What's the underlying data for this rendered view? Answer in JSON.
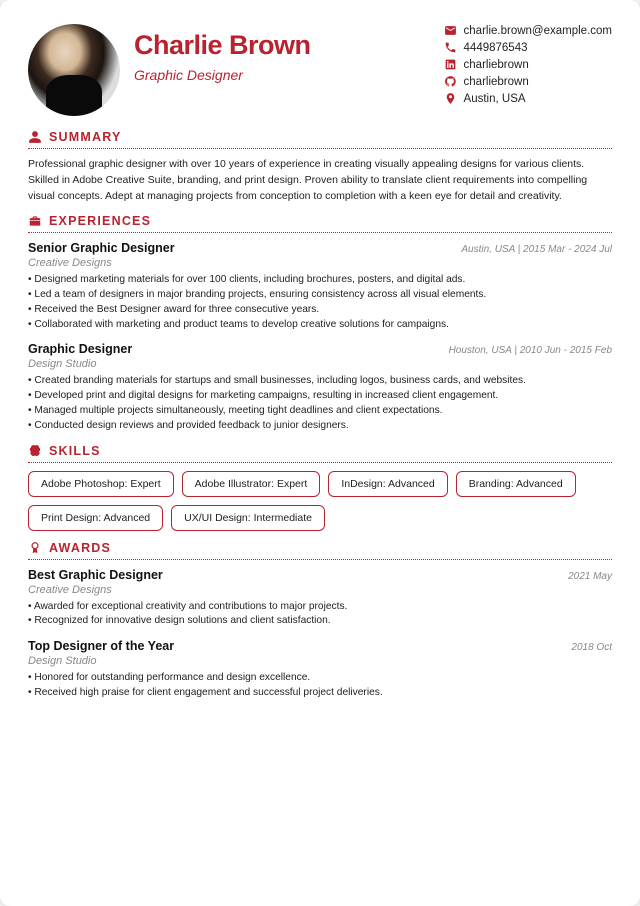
{
  "header": {
    "name": "Charlie Brown",
    "title": "Graphic Designer"
  },
  "contacts": {
    "email": "charlie.brown@example.com",
    "phone": "4449876543",
    "linkedin": "charliebrown",
    "github": "charliebrown",
    "location": "Austin, USA"
  },
  "sections": {
    "summary_label": "Summary",
    "experiences_label": "Experiences",
    "skills_label": "Skills",
    "awards_label": "Awards"
  },
  "summary": "Professional graphic designer with over 10 years of experience in creating visually appealing designs for various clients. Skilled in Adobe Creative Suite, branding, and print design. Proven ability to translate client requirements into compelling visual concepts. Adept at managing projects from conception to completion with a keen eye for detail and creativity.",
  "experiences": [
    {
      "title": "Senior Graphic Designer",
      "company": "Creative Designs",
      "meta": "Austin, USA  |  2015 Mar - 2024 Jul",
      "bullets": [
        "Designed marketing materials for over 100 clients, including brochures, posters, and digital ads.",
        "Led a team of designers in major branding projects, ensuring consistency across all visual elements.",
        "Received the Best Designer award for three consecutive years.",
        "Collaborated with marketing and product teams to develop creative solutions for campaigns."
      ]
    },
    {
      "title": "Graphic Designer",
      "company": "Design Studio",
      "meta": "Houston, USA  |  2010 Jun - 2015 Feb",
      "bullets": [
        "Created branding materials for startups and small businesses, including logos, business cards, and websites.",
        "Developed print and digital designs for marketing campaigns, resulting in increased client engagement.",
        "Managed multiple projects simultaneously, meeting tight deadlines and client expectations.",
        "Conducted design reviews and provided feedback to junior designers."
      ]
    }
  ],
  "skills": [
    "Adobe Photoshop: Expert",
    "Adobe Illustrator: Expert",
    "InDesign: Advanced",
    "Branding: Advanced",
    "Print Design: Advanced",
    "UX/UI Design: Intermediate"
  ],
  "awards": [
    {
      "title": "Best Graphic Designer",
      "company": "Creative Designs",
      "meta": "2021 May",
      "bullets": [
        "Awarded for exceptional creativity and contributions to major projects.",
        "Recognized for innovative design solutions and client satisfaction."
      ]
    },
    {
      "title": "Top Designer of the Year",
      "company": "Design Studio",
      "meta": "2018 Oct",
      "bullets": [
        "Honored for outstanding performance and design excellence.",
        "Received high praise for client engagement and successful project deliveries."
      ]
    }
  ]
}
